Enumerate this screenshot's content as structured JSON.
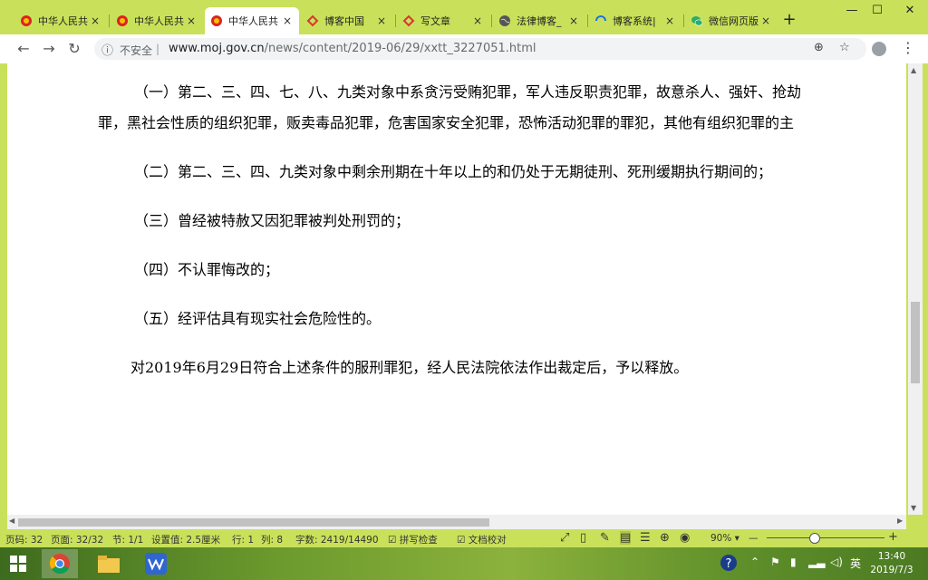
{
  "tabs": [
    {
      "title": "中华人民共",
      "icon": "emblem-icon",
      "close": "×"
    },
    {
      "title": "中华人民共",
      "icon": "emblem-icon",
      "close": "×"
    },
    {
      "title": "中华人民共",
      "icon": "emblem-icon",
      "close": "×"
    },
    {
      "title": "博客中国",
      "icon": "blogchina-icon",
      "close": "×"
    },
    {
      "title": "写文章",
      "icon": "blogchina-icon",
      "close": "×"
    },
    {
      "title": "法律博客_",
      "icon": "globe-icon",
      "close": "×"
    },
    {
      "title": "博客系统|",
      "icon": "loading-icon",
      "close": "×"
    },
    {
      "title": "微信网页版",
      "icon": "wechat-icon",
      "close": "×"
    }
  ],
  "window": {
    "minimize": "—",
    "maximize": "☐",
    "close": "✕",
    "new_tab": "+"
  },
  "address": {
    "insecure_label": "不安全",
    "separator": "|",
    "domain": "www.moj.gov.cn",
    "path": "/news/content/2019-06/29/xxtt_3227051.html"
  },
  "article": {
    "p1_line1": "（一）第二、三、四、七、八、九类对象中系贪污受贿犯罪，军人违反职责犯罪，故意杀人、强奸、抢劫",
    "p1_line2": "罪，黑社会性质的组织犯罪，贩卖毒品犯罪，危害国家安全犯罪，恐怖活动犯罪的罪犯，其他有组织犯罪的主",
    "p2": "（二）第二、三、四、九类对象中剩余刑期在十年以上的和仍处于无期徒刑、死刑缓期执行期间的；",
    "p3": "（三）曾经被特赦又因犯罪被判处刑罚的；",
    "p4": "（四）不认罪悔改的；",
    "p5": "（五）经评估具有现实社会危险性的。",
    "p6": "对2019年6月29日符合上述条件的服刑罪犯，经人民法院依法作出裁定后，予以释放。"
  },
  "status": {
    "page_code": "页码: 32",
    "pages": "页面: 32/32",
    "section": "节: 1/1",
    "setting": "设置值: 2.5厘米",
    "row": "行: 1",
    "col": "列: 8",
    "word_count": "字数: 2419/14490",
    "spellcheck": "拼写检查",
    "doc_check": "文档校对",
    "zoom": "90%",
    "zoom_minus": "—",
    "zoom_plus": "+"
  },
  "taskbar": {
    "time": "13:40",
    "date": "2019/7/3",
    "ime": "英"
  },
  "colors": {
    "chrome": "#c9e15a",
    "page": "#ffffff",
    "text": "#000000"
  }
}
